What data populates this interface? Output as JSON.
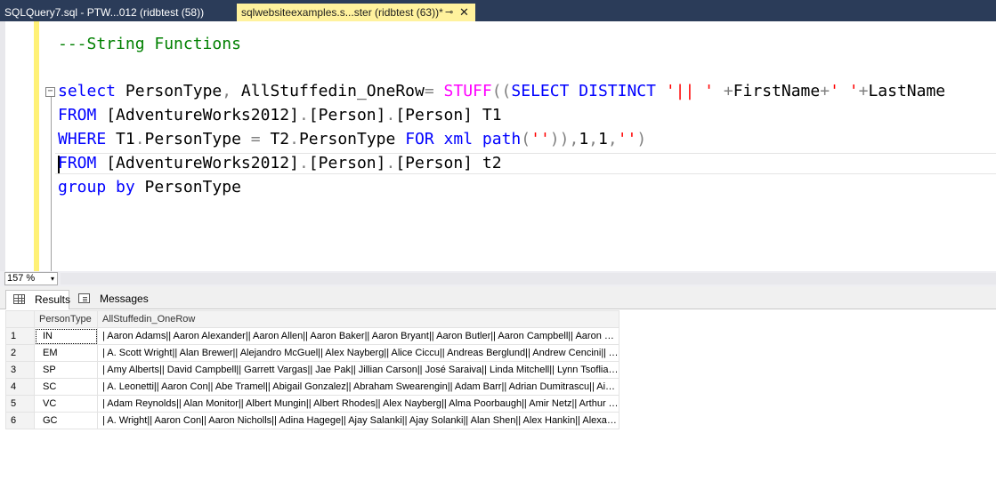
{
  "tabs": [
    {
      "label": "SQLQuery7.sql - PTW...012 (ridbtest (58))",
      "active": false
    },
    {
      "label": "sqlwebsiteexamples.s...ster (ridbtest (63))*",
      "active": true
    }
  ],
  "tab_pin_glyph": "⊸",
  "tab_close_glyph": "✕",
  "editor": {
    "comment": "---String Functions",
    "lines": {
      "l1": {
        "select": "select",
        "a": " PersonType",
        "comma1": ",",
        "b": " AllStuffedin_OneRow",
        "eq": "=",
        "sp1": " ",
        "stuff": "STUFF",
        "paren1": "((",
        "selectdistinct": "SELECT DISTINCT",
        "sp2": " ",
        "s1": "'|| '",
        "sp3": " ",
        "plus1": "+",
        "fn1": "FirstName",
        "plus2": "+",
        "s2": "' '",
        "plus3": "+",
        "ln1": "LastName"
      },
      "l2": {
        "from": "FROM",
        "rest": " [AdventureWorks2012]",
        "dot1": ".",
        "p": "[Person]",
        "dot2": ".",
        "q": "[Person] T1"
      },
      "l3": {
        "where": "WHERE",
        "a": " T1",
        "dot1": ".",
        "b": "PersonType ",
        "eq": "=",
        "c": " T2",
        "dot2": ".",
        "d": "PersonType ",
        "for": "FOR",
        "sp": " ",
        "xml": "xml",
        "sp2": " ",
        "path": "path",
        "paren": "(",
        "s": "''",
        "paren2": ")),",
        "n1": "1",
        "c1": ",",
        "n2": "1",
        "c2": ",",
        "s3": "''",
        "paren3": ")"
      },
      "l4": {
        "from": "FROM",
        "rest": " [AdventureWorks2012]",
        "dot1": ".",
        "p": "[Person]",
        "dot2": ".",
        "q": "[Person] t2"
      },
      "l5": {
        "group": "group by",
        "rest": " PersonType"
      }
    }
  },
  "zoom": {
    "value": "157 %",
    "arrow": "▾"
  },
  "results_tabs": {
    "results": "Results",
    "messages": "Messages"
  },
  "grid": {
    "headers": [
      "PersonType",
      "AllStuffedin_OneRow"
    ],
    "rows": [
      {
        "n": "1",
        "type": "IN",
        "value": "| Aaron Adams|| Aaron Alexander|| Aaron Allen|| Aaron Baker|| Aaron Bryant|| Aaron Butler|| Aaron Campbell|| Aaron Carter|..."
      },
      {
        "n": "2",
        "type": "EM",
        "value": "| A. Scott Wright|| Alan Brewer|| Alejandro McGuel|| Alex Nayberg|| Alice Ciccu|| Andreas Berglund|| Andrew Cencini|| Andr..."
      },
      {
        "n": "3",
        "type": "SP",
        "value": "| Amy Alberts|| David Campbell|| Garrett Vargas|| Jae Pak|| Jillian Carson|| José Saraiva|| Linda Mitchell|| Lynn Tsoflias|| Mic..."
      },
      {
        "n": "4",
        "type": "SC",
        "value": "| A. Leonetti|| Aaron Con|| Abe Tramel|| Abigail Gonzalez|| Abraham Swearengin|| Adam Barr|| Adrian Dumitrascu|| Aidan D..."
      },
      {
        "n": "5",
        "type": "VC",
        "value": "| Adam Reynolds|| Alan Monitor|| Albert Mungin|| Albert Rhodes|| Alex Nayberg|| Alma Poorbaugh|| Amir Netz|| Arthur Yasin..."
      },
      {
        "n": "6",
        "type": "GC",
        "value": "| A. Wright|| Aaron Con|| Aaron Nicholls|| Adina Hagege|| Ajay Salanki|| Ajay Solanki|| Alan Shen|| Alex Hankin|| Alexandre ..."
      }
    ]
  }
}
